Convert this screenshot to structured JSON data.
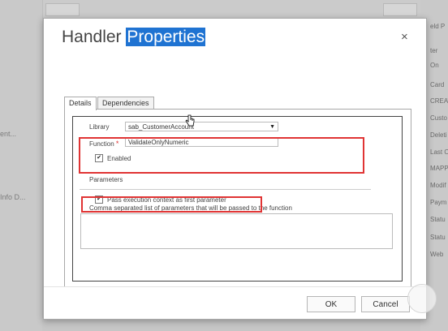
{
  "background": {
    "left_items": [
      "ent...",
      "Info D..."
    ],
    "right_items": [
      "eld P",
      "ter",
      "On",
      "Card",
      "CREAT",
      "Custo",
      "Deleti",
      "Last O",
      "MAPP",
      "Modif",
      "Paym",
      "Statu",
      "Statu",
      "Web"
    ]
  },
  "dialog": {
    "title_plain": "Handler ",
    "title_highlight": "Properties",
    "close_label": "×",
    "tabs": [
      {
        "label": "Details",
        "active": true
      },
      {
        "label": "Dependencies",
        "active": false
      }
    ],
    "library_label": "Library",
    "library_value": "sab_CustomerAccount",
    "library_arrow": "▼",
    "function_label": "Function",
    "required_mark": "*",
    "function_value": "ValidateOnlyNumeric",
    "enabled_label": "Enabled",
    "enabled_checked": true,
    "parameters_heading": "Parameters",
    "pass_context_label": "Pass execution context as first parameter",
    "pass_context_checked": true,
    "params_caption": "Comma separated list of parameters that will be passed to the function",
    "params_value": "",
    "ok_label": "OK",
    "cancel_label": "Cancel",
    "check_glyph": "✔"
  },
  "colors": {
    "highlight": "#1f73d2",
    "annotation_red": "#e03434"
  }
}
